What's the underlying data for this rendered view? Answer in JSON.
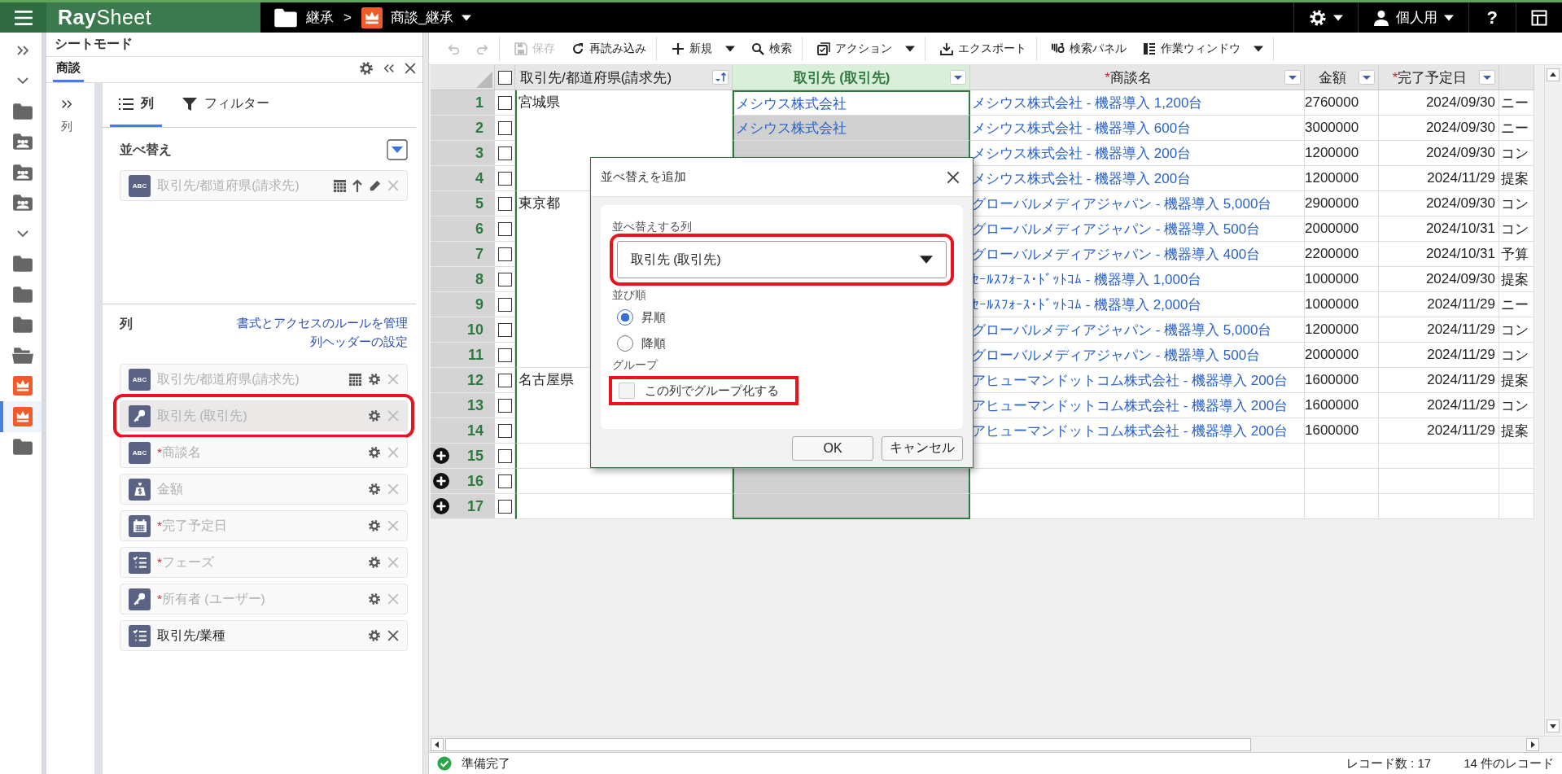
{
  "topbar": {
    "logo": "**Ray**Sheet",
    "breadcrumb": [
      {
        "kind": "folder",
        "label": "継承",
        "caret": false
      },
      {
        "kind": "app",
        "label": "商談_継承",
        "caret": true
      }
    ],
    "separator": ">",
    "user": "個人用",
    "help": "?"
  },
  "rail": [
    {
      "kind": "expand",
      "selected": false
    },
    {
      "kind": "chevron",
      "selected": false
    },
    {
      "kind": "folder",
      "selected": false
    },
    {
      "kind": "shared",
      "selected": false
    },
    {
      "kind": "shared",
      "selected": false
    },
    {
      "kind": "shared",
      "selected": false
    },
    {
      "kind": "chevron",
      "selected": false
    },
    {
      "kind": "folder",
      "selected": false
    },
    {
      "kind": "folder",
      "selected": false
    },
    {
      "kind": "folder",
      "selected": false
    },
    {
      "kind": "open-folder",
      "selected": false
    },
    {
      "kind": "app",
      "selected": false
    },
    {
      "kind": "app",
      "selected": true
    },
    {
      "kind": "folder",
      "selected": false
    }
  ],
  "panel": {
    "title": "シートモード",
    "tab": "商談",
    "side_label": "列",
    "tabs": [
      {
        "kind": "columns",
        "label": "列",
        "selected": true
      },
      {
        "kind": "filter",
        "label": "フィルター",
        "selected": false
      }
    ],
    "sort": {
      "title": "並べ替え",
      "items": [
        {
          "kind": "asc",
          "badge": "ABC",
          "label": "取引先/都道府県(請求先)"
        }
      ]
    },
    "columns": {
      "title": "列",
      "links": [
        "書式とアクセスのルールを管理",
        "列ヘッダーの設定"
      ],
      "items": [
        {
          "kind": "text",
          "badge": "ABC",
          "label": "取引先/都道府県(請求先)",
          "dimmed": true,
          "sorted": true,
          "highlighted": false
        },
        {
          "kind": "lookup",
          "label": "取引先 (取引先)",
          "dimmed": true,
          "sorted": false,
          "highlighted": true
        },
        {
          "kind": "text",
          "badge": "ABC",
          "required_mark": "*",
          "label": "商談名",
          "dimmed": true,
          "sorted": false,
          "highlighted": false
        },
        {
          "kind": "currency",
          "label": "金額",
          "dimmed": true,
          "sorted": false,
          "highlighted": false
        },
        {
          "kind": "date",
          "required_mark": "*",
          "label": "完了予定日",
          "dimmed": true,
          "sorted": false,
          "highlighted": false
        },
        {
          "kind": "picklist",
          "required_mark": "*",
          "label": "フェーズ",
          "dimmed": true,
          "sorted": false,
          "highlighted": false
        },
        {
          "kind": "lookup",
          "required_mark": "*",
          "label": "所有者 (ユーザー)",
          "dimmed": true,
          "sorted": false,
          "highlighted": false
        },
        {
          "kind": "picklist",
          "label": "取引先/業種",
          "dimmed": false,
          "sorted": false,
          "highlighted": false
        }
      ]
    }
  },
  "toolbar": [
    {
      "kind": "undo",
      "disabled": true,
      "separator_after": false
    },
    {
      "kind": "redo",
      "disabled": true,
      "separator_after": true
    },
    {
      "kind": "save",
      "label": "保存",
      "disabled": true,
      "separator_after": false
    },
    {
      "kind": "reload",
      "label": "再読み込み",
      "disabled": false,
      "separator_after": true
    },
    {
      "kind": "new",
      "label": "新規",
      "caret": true,
      "disabled": false,
      "separator_after": false
    },
    {
      "kind": "search",
      "label": "検索",
      "disabled": false,
      "separator_after": true
    },
    {
      "kind": "action",
      "label": "アクション",
      "caret": true,
      "disabled": false,
      "separator_after": true
    },
    {
      "kind": "export",
      "label": "エクスポート",
      "disabled": false,
      "separator_after": true
    },
    {
      "kind": "search-panel",
      "label": "検索パネル",
      "disabled": false,
      "separator_after": false
    },
    {
      "kind": "work-window",
      "label": "作業ウィンドウ",
      "caret": true,
      "disabled": false,
      "separator_after": true
    }
  ],
  "grid": {
    "all_checked": false,
    "columns": [
      {
        "label": "取引先/都道府県(請求先)",
        "kind": "sorted",
        "selected": false
      },
      {
        "label": "取引先 (取引先)",
        "kind": "filter",
        "selected": true
      },
      {
        "required_mark": "*",
        "label": "商談名",
        "kind": "filter",
        "selected": false
      },
      {
        "label": "金額",
        "kind": "filter",
        "selected": false
      },
      {
        "required_mark": "*",
        "label": "完了予定日",
        "kind": "filter",
        "selected": false
      }
    ],
    "rows": [
      {
        "number": "1",
        "kind": "record",
        "checked": false,
        "prefecture": "宮城県",
        "account": "メシウス株式会社",
        "active": true,
        "name": "メシウス株式会社 - 機器導入 1,200台",
        "amount": "2760000",
        "date": "2024/09/30",
        "column_7": "ニー"
      },
      {
        "number": "2",
        "kind": "record",
        "checked": false,
        "account": "メシウス株式会社",
        "active": false,
        "name": "メシウス株式会社 - 機器導入 600台",
        "amount": "3000000",
        "date": "2024/09/30",
        "column_7": "ニー"
      },
      {
        "number": "3",
        "kind": "record",
        "checked": false,
        "active": false,
        "name": "メシウス株式会社 - 機器導入 200台",
        "amount": "1200000",
        "date": "2024/09/30",
        "column_7": "コン"
      },
      {
        "number": "4",
        "kind": "record",
        "checked": false,
        "name": "メシウス株式会社 - 機器導入 200台",
        "amount": "1200000",
        "date": "2024/11/29",
        "column_7": "提案"
      },
      {
        "number": "5",
        "kind": "record",
        "checked": false,
        "prefecture": "東京都",
        "name": "グローバルメディアジャパン - 機器導入 5,000台",
        "amount": "2900000",
        "date": "2024/09/30",
        "column_7": "コン"
      },
      {
        "number": "6",
        "kind": "record",
        "checked": false,
        "name": "グローバルメディアジャパン - 機器導入 500台",
        "amount": "2000000",
        "date": "2024/10/31",
        "column_7": "コン"
      },
      {
        "number": "7",
        "kind": "record",
        "checked": false,
        "name": "グローバルメディアジャパン - 機器導入 400台",
        "amount": "2200000",
        "date": "2024/10/31",
        "column_7": "予算"
      },
      {
        "number": "8",
        "kind": "record",
        "checked": false,
        "name": "ｾｰﾙｽﾌｫｰｽ･ﾄﾞｯﾄｺﾑ - 機器導入 1,000台",
        "amount": "1000000",
        "date": "2024/09/30",
        "column_7": "提案"
      },
      {
        "number": "9",
        "kind": "record",
        "checked": false,
        "name": "ｾｰﾙｽﾌｫｰｽ･ﾄﾞｯﾄｺﾑ - 機器導入 2,000台",
        "amount": "1000000",
        "date": "2024/11/29",
        "column_7": "ニー"
      },
      {
        "number": "10",
        "kind": "record",
        "checked": false,
        "name": "グローバルメディアジャパン - 機器導入 5,000台",
        "amount": "1200000",
        "date": "2024/11/29",
        "column_7": "コン"
      },
      {
        "number": "11",
        "kind": "record",
        "checked": false,
        "name": "グローバルメディアジャパン - 機器導入 500台",
        "amount": "2000000",
        "date": "2024/11/29",
        "column_7": "コン"
      },
      {
        "number": "12",
        "kind": "record",
        "checked": false,
        "prefecture": "名古屋県",
        "name": "アヒューマンドットコム株式会社 - 機器導入 200台",
        "amount": "1600000",
        "date": "2024/11/29",
        "column_7": "提案"
      },
      {
        "number": "13",
        "kind": "record",
        "checked": false,
        "name": "アヒューマンドットコム株式会社 - 機器導入 200台",
        "amount": "1600000",
        "date": "2024/11/29",
        "column_7": "コン"
      },
      {
        "number": "14",
        "kind": "record",
        "checked": false,
        "name": "アヒューマンドットコム株式会社 - 機器導入 200台",
        "amount": "1600000",
        "date": "2024/11/29",
        "column_7": "提案"
      },
      {
        "number": "15",
        "kind": "new",
        "checked": false
      },
      {
        "number": "16",
        "kind": "new",
        "checked": false,
        "active": false
      },
      {
        "number": "17",
        "kind": "new",
        "checked": false,
        "active": false
      }
    ]
  },
  "dialog": {
    "title": "並べ替えを追加",
    "field_label": "並べ替えする列",
    "field_value": "取引先 (取引先)",
    "field_highlighted": true,
    "order_label": "並び順",
    "orders": [
      {
        "label": "昇順",
        "selected": true
      },
      {
        "label": "降順",
        "selected": false
      }
    ],
    "group_label": "グループ",
    "group_checkbox": {
      "label": "この列でグループ化する",
      "checked": false,
      "disabled": true,
      "highlighted": true
    },
    "buttons": [
      {
        "label": "OK"
      },
      {
        "label": "キャンセル"
      }
    ]
  },
  "status": {
    "state": "準備完了",
    "record_count": "レコード数 :  17",
    "records": "14 件のレコード"
  }
}
